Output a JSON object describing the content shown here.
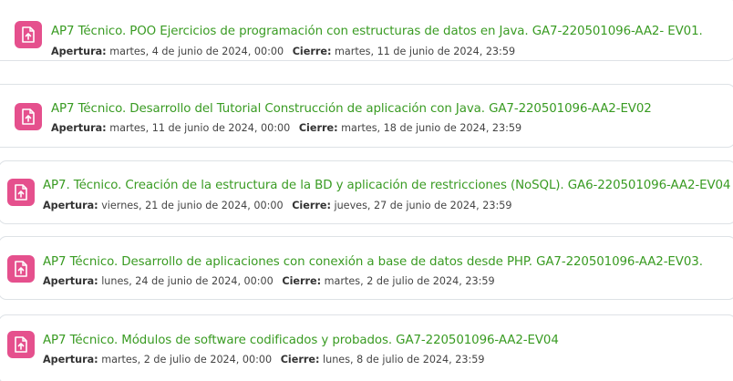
{
  "activities": [
    {
      "title": "AP7 Técnico. POO Ejercicios de programación con estructuras de datos en Java. GA7-220501096-AA2- EV01.",
      "opening_label": "Apertura:",
      "opening_date": "martes, 4 de junio de 2024, 00:00",
      "closing_label": "Cierre:",
      "closing_date": "martes, 11 de junio de 2024, 23:59",
      "icon": "assignment-upload-icon"
    },
    {
      "title": "AP7 Técnico. Desarrollo del Tutorial Construcción de aplicación con Java. GA7-220501096-AA2-EV02",
      "opening_label": "Apertura:",
      "opening_date": "martes, 11 de junio de 2024, 00:00",
      "closing_label": "Cierre:",
      "closing_date": "martes, 18 de junio de 2024, 23:59",
      "icon": "assignment-upload-icon"
    },
    {
      "title": "AP7. Técnico. Creación de la estructura de la BD y aplicación de restricciones (NoSQL). GA6-220501096-AA2-EV04",
      "opening_label": "Apertura:",
      "opening_date": "viernes, 21 de junio de 2024, 00:00",
      "closing_label": "Cierre:",
      "closing_date": "jueves, 27 de junio de 2024, 23:59",
      "icon": "assignment-upload-icon"
    },
    {
      "title": "AP7 Técnico. Desarrollo de aplicaciones con conexión a base de datos desde PHP. GA7-220501096-AA2-EV03.",
      "opening_label": "Apertura:",
      "opening_date": "lunes, 24 de junio de 2024, 00:00",
      "closing_label": "Cierre:",
      "closing_date": "martes, 2 de julio de 2024, 23:59",
      "icon": "assignment-upload-icon"
    },
    {
      "title": "AP7 Técnico. Módulos de software codificados y probados. GA7-220501096-AA2-EV04",
      "opening_label": "Apertura:",
      "opening_date": "martes, 2 de julio de 2024, 00:00",
      "closing_label": "Cierre:",
      "closing_date": "lunes, 8 de julio de 2024, 23:59",
      "icon": "assignment-upload-icon"
    }
  ],
  "colors": {
    "title_green": "#399b22",
    "icon_pink": "#e5508d",
    "card_border": "#dee2e6"
  }
}
